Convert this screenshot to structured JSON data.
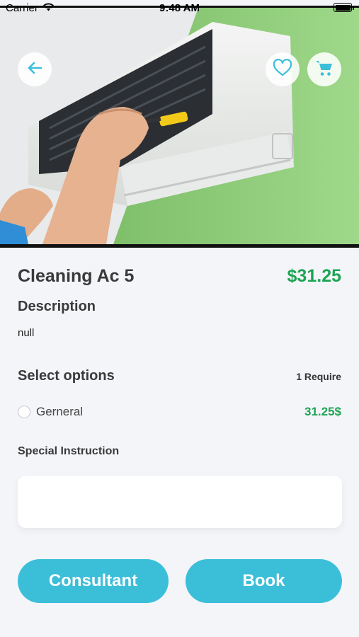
{
  "status_bar": {
    "carrier": "Carrier",
    "time": "9:48 AM"
  },
  "header": {
    "back_icon": "arrow-left-icon",
    "favorite_icon": "heart-icon",
    "cart_icon": "cart-icon",
    "accent_color": "#3bbfd9"
  },
  "product": {
    "title": "Cleaning Ac 5",
    "price": "$31.25",
    "price_color": "#1ea453"
  },
  "description": {
    "heading": "Description",
    "text": "null"
  },
  "options": {
    "heading": "Select options",
    "requirement": "1 Require",
    "items": [
      {
        "label": "Gerneral",
        "price": "31.25$",
        "selected": false
      }
    ]
  },
  "special_instruction": {
    "heading": "Special Instruction",
    "value": "",
    "placeholder": ""
  },
  "actions": {
    "consultant_label": "Consultant",
    "book_label": "Book",
    "button_color": "#3bbfd9"
  }
}
